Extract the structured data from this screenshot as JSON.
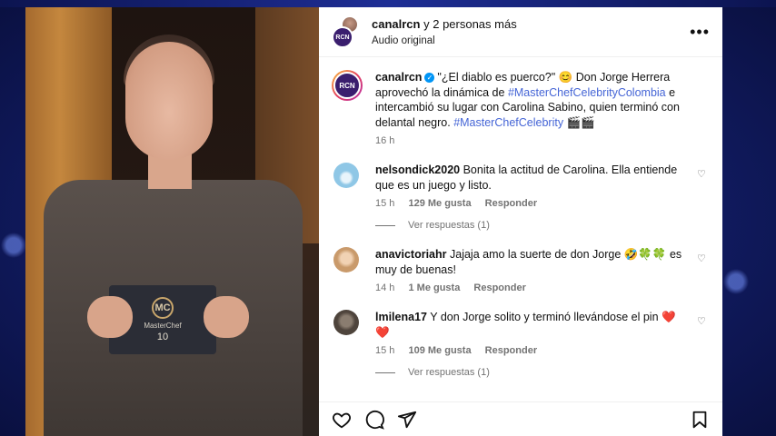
{
  "header": {
    "username": "canalrcn",
    "others": "y 2 personas más",
    "audio": "Audio original",
    "avatar_text": "RCN"
  },
  "caption": {
    "username": "canalrcn",
    "part1": "\"¿El diablo es puerco?\" 😊 Don Jorge Herrera aprovechó la dinámica de ",
    "hashtag1": "#MasterChefCelebrityColombia",
    "part2": " e intercambió su lugar con Carolina Sabino, quien terminó con delantal negro. ",
    "hashtag2": "#MasterChefCelebrity",
    "part3": " 🎬🎬",
    "time": "16 h"
  },
  "comments": [
    {
      "username": "nelsondick2020",
      "text": "Bonita la actitud de Carolina. Ella entiende que es un juego y listo.",
      "time": "15 h",
      "likes": "129 Me gusta",
      "reply": "Responder",
      "replies": "Ver respuestas (1)",
      "avatar_color": "#8fc7e6"
    },
    {
      "username": "anavictoriahr",
      "text": "Jajaja amo la suerte de don Jorge 🤣🍀🍀 es muy de buenas!",
      "time": "14 h",
      "likes": "1 Me gusta",
      "reply": "Responder",
      "avatar_color": "#d9b58f"
    },
    {
      "username": "lmilena17",
      "text": "Y don Jorge solito y terminó llevándose el pin ❤️❤️",
      "time": "15 h",
      "likes": "109 Me gusta",
      "reply": "Responder",
      "replies": "Ver respuestas (1)",
      "avatar_color": "#6b5f55"
    }
  ],
  "video": {
    "card_logo": "MC",
    "card_text": "MasterChef",
    "card_num": "10"
  },
  "icons": [
    "heart-icon",
    "comment-icon",
    "share-icon",
    "bookmark-icon",
    "more-icon",
    "verified-icon"
  ],
  "colors": {
    "hashtag": "#4565d6",
    "verified": "#0095f6",
    "meta": "#737373"
  }
}
